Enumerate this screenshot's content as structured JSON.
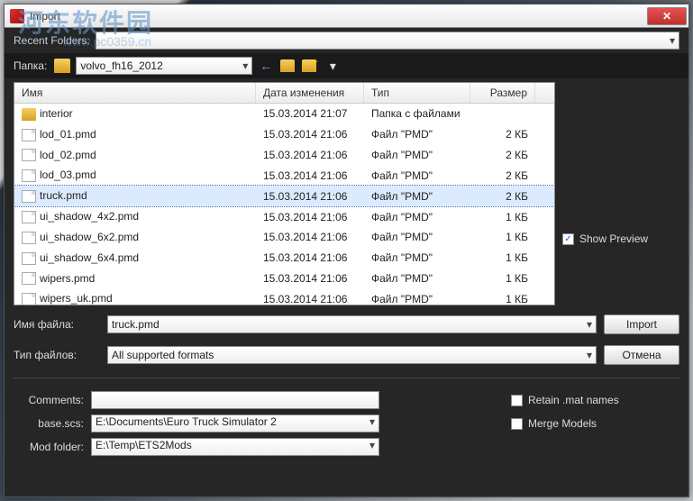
{
  "watermark": {
    "main": "河东软件园",
    "sub": "www.pc0359.cn"
  },
  "window": {
    "title": "Import"
  },
  "recent_folders": {
    "label": "Recent Folders:"
  },
  "folder_bar": {
    "label": "Папка:",
    "current": "volvo_fh16_2012"
  },
  "columns": {
    "name": "Имя",
    "date": "Дата изменения",
    "type": "Тип",
    "size": "Размер"
  },
  "files": [
    {
      "name": "interior",
      "date": "15.03.2014 21:07",
      "type": "Папка с файлами",
      "size": "",
      "icon": "folder"
    },
    {
      "name": "lod_01.pmd",
      "date": "15.03.2014 21:06",
      "type": "Файл \"PMD\"",
      "size": "2 КБ",
      "icon": "file"
    },
    {
      "name": "lod_02.pmd",
      "date": "15.03.2014 21:06",
      "type": "Файл \"PMD\"",
      "size": "2 КБ",
      "icon": "file"
    },
    {
      "name": "lod_03.pmd",
      "date": "15.03.2014 21:06",
      "type": "Файл \"PMD\"",
      "size": "2 КБ",
      "icon": "file"
    },
    {
      "name": "truck.pmd",
      "date": "15.03.2014 21:06",
      "type": "Файл \"PMD\"",
      "size": "2 КБ",
      "icon": "file",
      "selected": true
    },
    {
      "name": "ui_shadow_4x2.pmd",
      "date": "15.03.2014 21:06",
      "type": "Файл \"PMD\"",
      "size": "1 КБ",
      "icon": "file"
    },
    {
      "name": "ui_shadow_6x2.pmd",
      "date": "15.03.2014 21:06",
      "type": "Файл \"PMD\"",
      "size": "1 КБ",
      "icon": "file"
    },
    {
      "name": "ui_shadow_6x4.pmd",
      "date": "15.03.2014 21:06",
      "type": "Файл \"PMD\"",
      "size": "1 КБ",
      "icon": "file"
    },
    {
      "name": "wipers.pmd",
      "date": "15.03.2014 21:06",
      "type": "Файл \"PMD\"",
      "size": "1 КБ",
      "icon": "file"
    },
    {
      "name": "wipers_uk.pmd",
      "date": "15.03.2014 21:06",
      "type": "Файл \"PMD\"",
      "size": "1 КБ",
      "icon": "file"
    }
  ],
  "filename": {
    "label": "Имя файла:",
    "value": "truck.pmd"
  },
  "filetype": {
    "label": "Тип файлов:",
    "value": "All supported formats"
  },
  "buttons": {
    "import": "Import",
    "cancel": "Отмена"
  },
  "preview": {
    "label": "Show Preview",
    "checked": true
  },
  "bottom": {
    "comments": {
      "label": "Comments:",
      "value": ""
    },
    "basescs": {
      "label": "base.scs:",
      "value": "E:\\Documents\\Euro Truck Simulator 2"
    },
    "modfolder": {
      "label": "Mod folder:",
      "value": "E:\\Temp\\ETS2Mods"
    },
    "retain": {
      "label": "Retain .mat names",
      "checked": false
    },
    "merge": {
      "label": "Merge Models",
      "checked": false
    }
  }
}
